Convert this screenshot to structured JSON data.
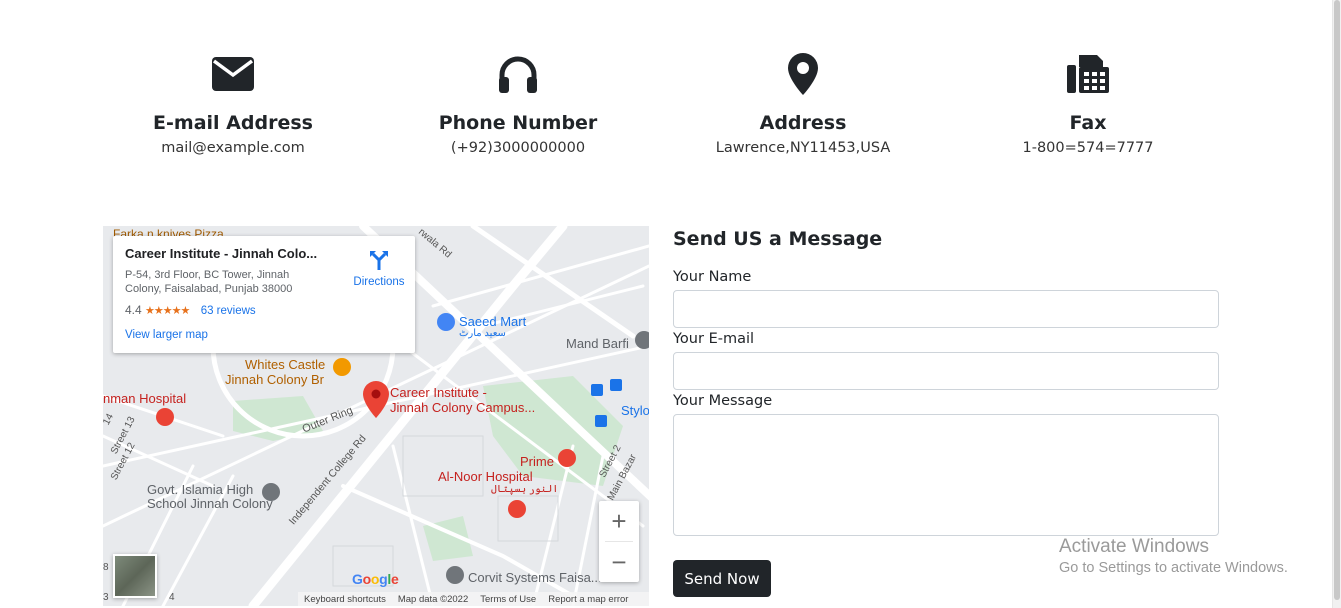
{
  "contact_items": [
    {
      "icon": "envelope-icon",
      "title": "E-mail Address",
      "value": "mail@example.com"
    },
    {
      "icon": "headphones-icon",
      "title": "Phone Number",
      "value": "(+92)3000000000"
    },
    {
      "icon": "map-marker-icon",
      "title": "Address",
      "value": "Lawrence,NY11453,USA"
    },
    {
      "icon": "fax-icon",
      "title": "Fax",
      "value": "1-800=574=7777"
    }
  ],
  "map": {
    "place_name": "Career Institute - Jinnah Colo...",
    "place_address": "P-54, 3rd Floor, BC Tower, Jinnah Colony, Faisalabad, Punjab 38000",
    "rating": "4.4",
    "stars": "★★★★★",
    "reviews": "63 reviews",
    "directions": "Directions",
    "larger_map": "View larger map",
    "labels": {
      "pizza": "Farka n kniyes Pizza",
      "wala_rd": "rwala Rd",
      "saeed_mart": "Saeed Mart",
      "saeed_mart_ur": "سعید مارٹ",
      "mand_barfi": "Mand Barfi",
      "whites_castle": "Whites Castle",
      "jinnah_colony_br": "Jinnah Colony Br",
      "career_1": "Career Institute -",
      "career_2": "Jinnah Colony Campus...",
      "hospital": "nman Hospital",
      "outer_ring": "Outer Ring",
      "stylo": "Stylo",
      "street13": "Street 13",
      "street12": "Street 12",
      "street14": "14",
      "prime": "Prime",
      "street2": "Street 2",
      "main_bazar": "Main Bazar",
      "independent": "Independent College Rd",
      "alnoor": "Al-Noor Hospital",
      "alnoor_ur": "النور ہسپتال",
      "govt1": "Govt. Islamia High",
      "govt2": "School Jinnah Colony",
      "corvit": "Corvit Systems Faisa.....",
      "s8": "8",
      "s4": "4",
      "s3": "3"
    },
    "google": "Google",
    "zoom_in": "+",
    "zoom_out": "−",
    "footer": {
      "shortcuts": "Keyboard shortcuts",
      "mapdata": "Map data ©2022",
      "terms": "Terms of Use",
      "report": "Report a map error"
    }
  },
  "form": {
    "title": "Send US a Message",
    "name_label": "Your Name",
    "email_label": "Your E-mail",
    "message_label": "Your Message",
    "name_value": "",
    "email_value": "",
    "message_value": "",
    "submit_label": "Send Now"
  },
  "watermark": {
    "line1": "Activate Windows",
    "line2": "Go to Settings to activate Windows."
  }
}
